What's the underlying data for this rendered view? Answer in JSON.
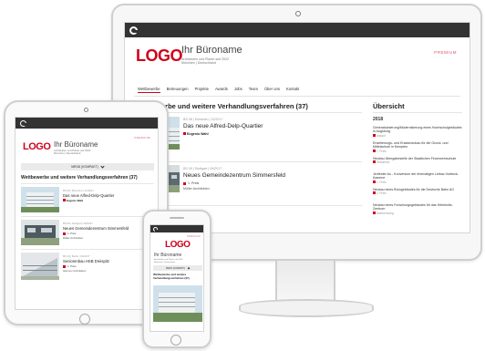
{
  "brand": {
    "logo": "LOGO",
    "name": "Ihr Büroname",
    "subtitle_line1": "Architekten und Planer seit 2022",
    "subtitle_line2": "München | Deutschland",
    "premium": "PREMIUM"
  },
  "nav": [
    "Wettbewerbe",
    "Betreuungen",
    "Projekte",
    "Awards",
    "Jobs",
    "Team",
    "Über uns",
    "Kontakt"
  ],
  "menu_label": "MENÜ (KOMPAKT)",
  "section_title": "Wettbewerbe und weitere Verhandlungsverfahren (37)",
  "section_title_short": "erbe und weitere Verhandlungsverfahren (37)",
  "overview_title": "Übersicht",
  "overview_year": "2018",
  "entries": [
    {
      "meta": "BS 08 | München | 12/2017",
      "title": "Das neue Alfred-Delp-Quartier",
      "author": "Eugenio Wahl",
      "prize": ""
    },
    {
      "meta": "BS 09 | Stuttgart | 09/2017",
      "title": "Neues Gemeindezentrum Simmersfeld",
      "author": "",
      "prize": "1. Preis",
      "prize_note": "Müller Architekten"
    },
    {
      "meta": "BS 10 | Berlin | 04/2017",
      "title": "Seniorenbau HSB Dreispitz",
      "author": "",
      "prize": "1. Preis",
      "prize_note": "Hammer Architekten"
    }
  ],
  "overview_items": [
    {
      "text": "Generalsanierung/Modernisierung eines Hochschulgebäudes in Augsburg",
      "note": "Ankauf"
    },
    {
      "text": "Erweiterungs- und Ersatzneubau für die Grund- und Mittelschule in Kempten",
      "note": "1. Preis"
    },
    {
      "text": "Neubau Übergabestelle der Staatlichen Feuerwehrschule",
      "note": "Teilnahme"
    },
    {
      "text": "Jenfelder Au - Konversion der ehemaligen Lettow-Vorbeck-Kaserne",
      "note": "1. Preis"
    },
    {
      "text": "Neubau eines Bürogebäudes für die Deutsche Bahn AG",
      "note": "2. Preis"
    },
    {
      "text": "Neubau eines Forschungsgebäudes für das Helmholtz-Zentrum",
      "note": "Anerkennung"
    }
  ],
  "colors": {
    "brand_red": "#d0021b",
    "dark_bar": "#333333",
    "premium_pink": "#e0526a"
  }
}
